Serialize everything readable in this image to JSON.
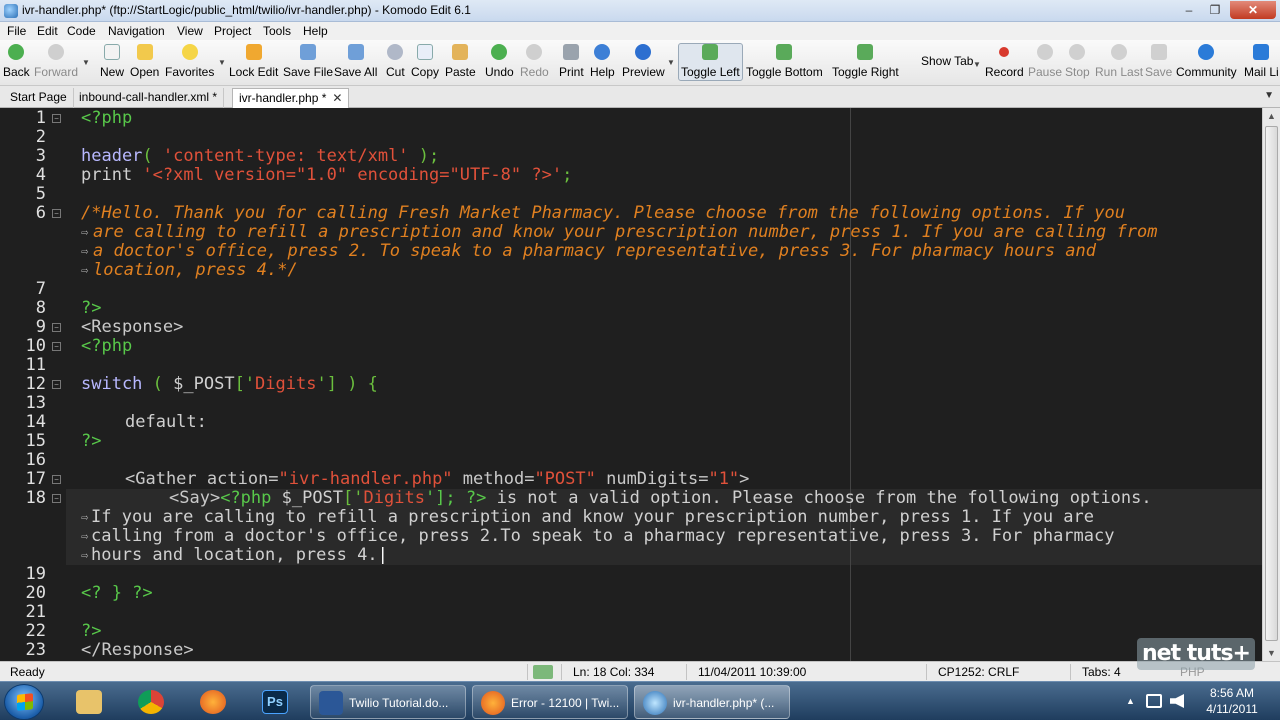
{
  "window": {
    "title": "ivr-handler.php* (ftp://StartLogic/public_html/twilio/ivr-handler.php) - Komodo Edit 6.1",
    "minimize": "–",
    "maximize": "❐",
    "close": "✕"
  },
  "menu": [
    "File",
    "Edit",
    "Code",
    "Navigation",
    "View",
    "Project",
    "Tools",
    "Help"
  ],
  "toolbar": {
    "back": "Back",
    "forward": "Forward",
    "new": "New",
    "open": "Open",
    "favorites": "Favorites",
    "lock_edit": "Lock Edit",
    "save_file": "Save File",
    "save_all": "Save All",
    "cut": "Cut",
    "copy": "Copy",
    "paste": "Paste",
    "undo": "Undo",
    "redo": "Redo",
    "print": "Print",
    "help": "Help",
    "preview": "Preview",
    "toggle_left": "Toggle Left",
    "toggle_bottom": "Toggle Bottom",
    "toggle_right": "Toggle Right",
    "show_tab": "Show Tab",
    "record": "Record",
    "pause": "Pause",
    "stop": "Stop",
    "run_last": "Run Last",
    "save": "Save",
    "community": "Community",
    "mail_list": "Mail Li"
  },
  "tabs": [
    {
      "label": "Start Page"
    },
    {
      "label": "inbound-call-handler.xml *"
    },
    {
      "label": "ivr-handler.php *",
      "close": "✕"
    }
  ],
  "tabs_more": "▼",
  "editor": {
    "line_numbers": [
      "1",
      "2",
      "3",
      "4",
      "5",
      "6",
      "7",
      "8",
      "9",
      "10",
      "11",
      "12",
      "13",
      "14",
      "15",
      "16",
      "17",
      "18",
      "19",
      "20",
      "21",
      "22",
      "23"
    ],
    "fold_open": "⊟",
    "wrap_mark": "⇨"
  },
  "code": {
    "l1": "<?php",
    "l3_fn": "header",
    "l3_open": "( ",
    "l3_str": "'content-type: text/xml'",
    "l3_close": " );",
    "l4_kw": "print ",
    "l4_str": "'<?xml version=\"1.0\" encoding=\"UTF-8\" ?>'",
    "l4_end": ";",
    "l6_a": "/*Hello. Thank you for calling Fresh Market Pharmacy. Please choose from the following options. If you",
    "l6_b": "are calling to refill a prescription and know your prescription number, press 1. If you are calling from",
    "l6_c": "a doctor's office, press 2. To speak to a pharmacy representative, press 3. For pharmacy hours and",
    "l6_d": "location, press 4.*/",
    "l8": "?>",
    "l9": "<Response>",
    "l10": "<?php",
    "l12_kw": "switch ",
    "l12_open": "( ",
    "l12_var": "$_POST",
    "l12_idx": "['",
    "l12_str": "Digits",
    "l12_idx2": "']",
    "l12_end": " ) {",
    "l14": "default:",
    "l15": "?>",
    "l17_tag": "<Gather ",
    "l17_a1": "action=",
    "l17_v1": "\"ivr-handler.php\"",
    "l17_a2": " method=",
    "l17_v2": "\"POST\"",
    "l17_a3": " numDigits=",
    "l17_v3": "\"1\"",
    "l17_end": ">",
    "l18_tag": "<Say>",
    "l18_php": "<?php ",
    "l18_var": "$_POST",
    "l18_idx": "['",
    "l18_str": "Digits",
    "l18_idx2": "']; ?>",
    "l18_text": " is not a valid option. Please choose from the following options.",
    "l18_b": "If you are calling to refill a prescription and know your prescription number, press 1. If you are",
    "l18_c": "calling from a doctor's office, press 2.To speak to a pharmacy representative, press 3. For pharmacy",
    "l18_d": "hours and location, press 4.",
    "l20": "<? } ?>",
    "l22": "?>",
    "l23": "</Response>"
  },
  "status": {
    "ready": "Ready",
    "position": "Ln: 18 Col: 334",
    "datetime": "11/04/2011 10:39:00",
    "encoding": "CP1252: CRLF",
    "tabs": "Tabs: 4",
    "language": "PHP"
  },
  "watermark": "net tuts+",
  "taskbar": {
    "tasks": [
      {
        "label": "Twilio Tutorial.do..."
      },
      {
        "label": "Error - 12100 | Twi..."
      },
      {
        "label": "ivr-handler.php* (..."
      }
    ],
    "clock_time": "8:56 AM",
    "clock_date": "4/11/2011",
    "tray_up": "▲"
  },
  "colors": {
    "editor_bg": "#1f1f1f",
    "php_tag": "#58c84a",
    "string": "#e0513a",
    "comment": "#e08020"
  }
}
